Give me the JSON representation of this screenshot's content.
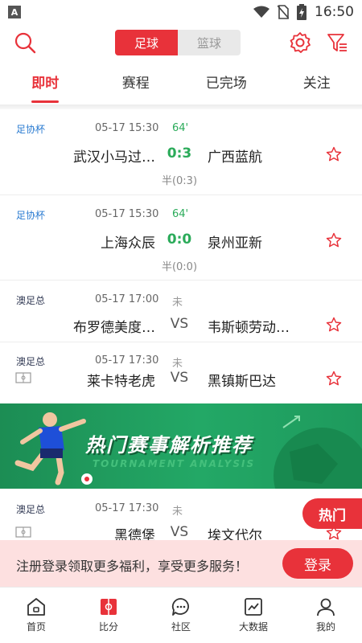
{
  "status_bar": {
    "time": "16:50",
    "indicator": "A"
  },
  "header": {
    "sport_tabs": [
      {
        "label": "足球",
        "active": true
      },
      {
        "label": "篮球",
        "active": false
      }
    ]
  },
  "tabs": [
    {
      "label": "即时",
      "active": true
    },
    {
      "label": "赛程",
      "active": false
    },
    {
      "label": "已完场",
      "active": false
    },
    {
      "label": "关注",
      "active": false
    }
  ],
  "matches": [
    {
      "league": "足协杯",
      "time": "05-17 15:30",
      "status": "64'",
      "home": "武汉小马过…",
      "score": "0:3",
      "away": "广西蓝航",
      "half": "半(0:3)"
    },
    {
      "league": "足协杯",
      "time": "05-17 15:30",
      "status": "64'",
      "home": "上海众辰",
      "score": "0:0",
      "away": "泉州亚新",
      "half": "半(0:0)"
    },
    {
      "league": "澳足总",
      "time": "05-17 17:00",
      "status": "未",
      "home": "布罗德美度…",
      "score": "VS",
      "away": "韦斯顿劳动…"
    },
    {
      "league": "澳足总",
      "time": "05-17 17:30",
      "status": "未",
      "home": "莱卡特老虎",
      "score": "VS",
      "away": "黑镇斯巴达"
    },
    {
      "league": "澳足总",
      "time": "05-17 17:30",
      "status": "未",
      "home": "黑德堡",
      "score": "VS",
      "away": "埃文代尔"
    }
  ],
  "banner": {
    "title": "热门赛事解析推荐",
    "subtitle": "TOURNAMENT ANALYSIS"
  },
  "hot_button": "热门",
  "register": {
    "text": "注册登录领取更多福利，享受更多服务！",
    "button": "登录"
  },
  "bottom_nav": [
    {
      "label": "首页",
      "icon": "home-icon"
    },
    {
      "label": "比分",
      "icon": "score-icon",
      "active": true
    },
    {
      "label": "社区",
      "icon": "community-icon"
    },
    {
      "label": "大数据",
      "icon": "chart-icon"
    },
    {
      "label": "我的",
      "icon": "profile-icon"
    }
  ],
  "colors": {
    "accent": "#e8323a",
    "live": "#2bab5a",
    "banner": "#23a866"
  }
}
